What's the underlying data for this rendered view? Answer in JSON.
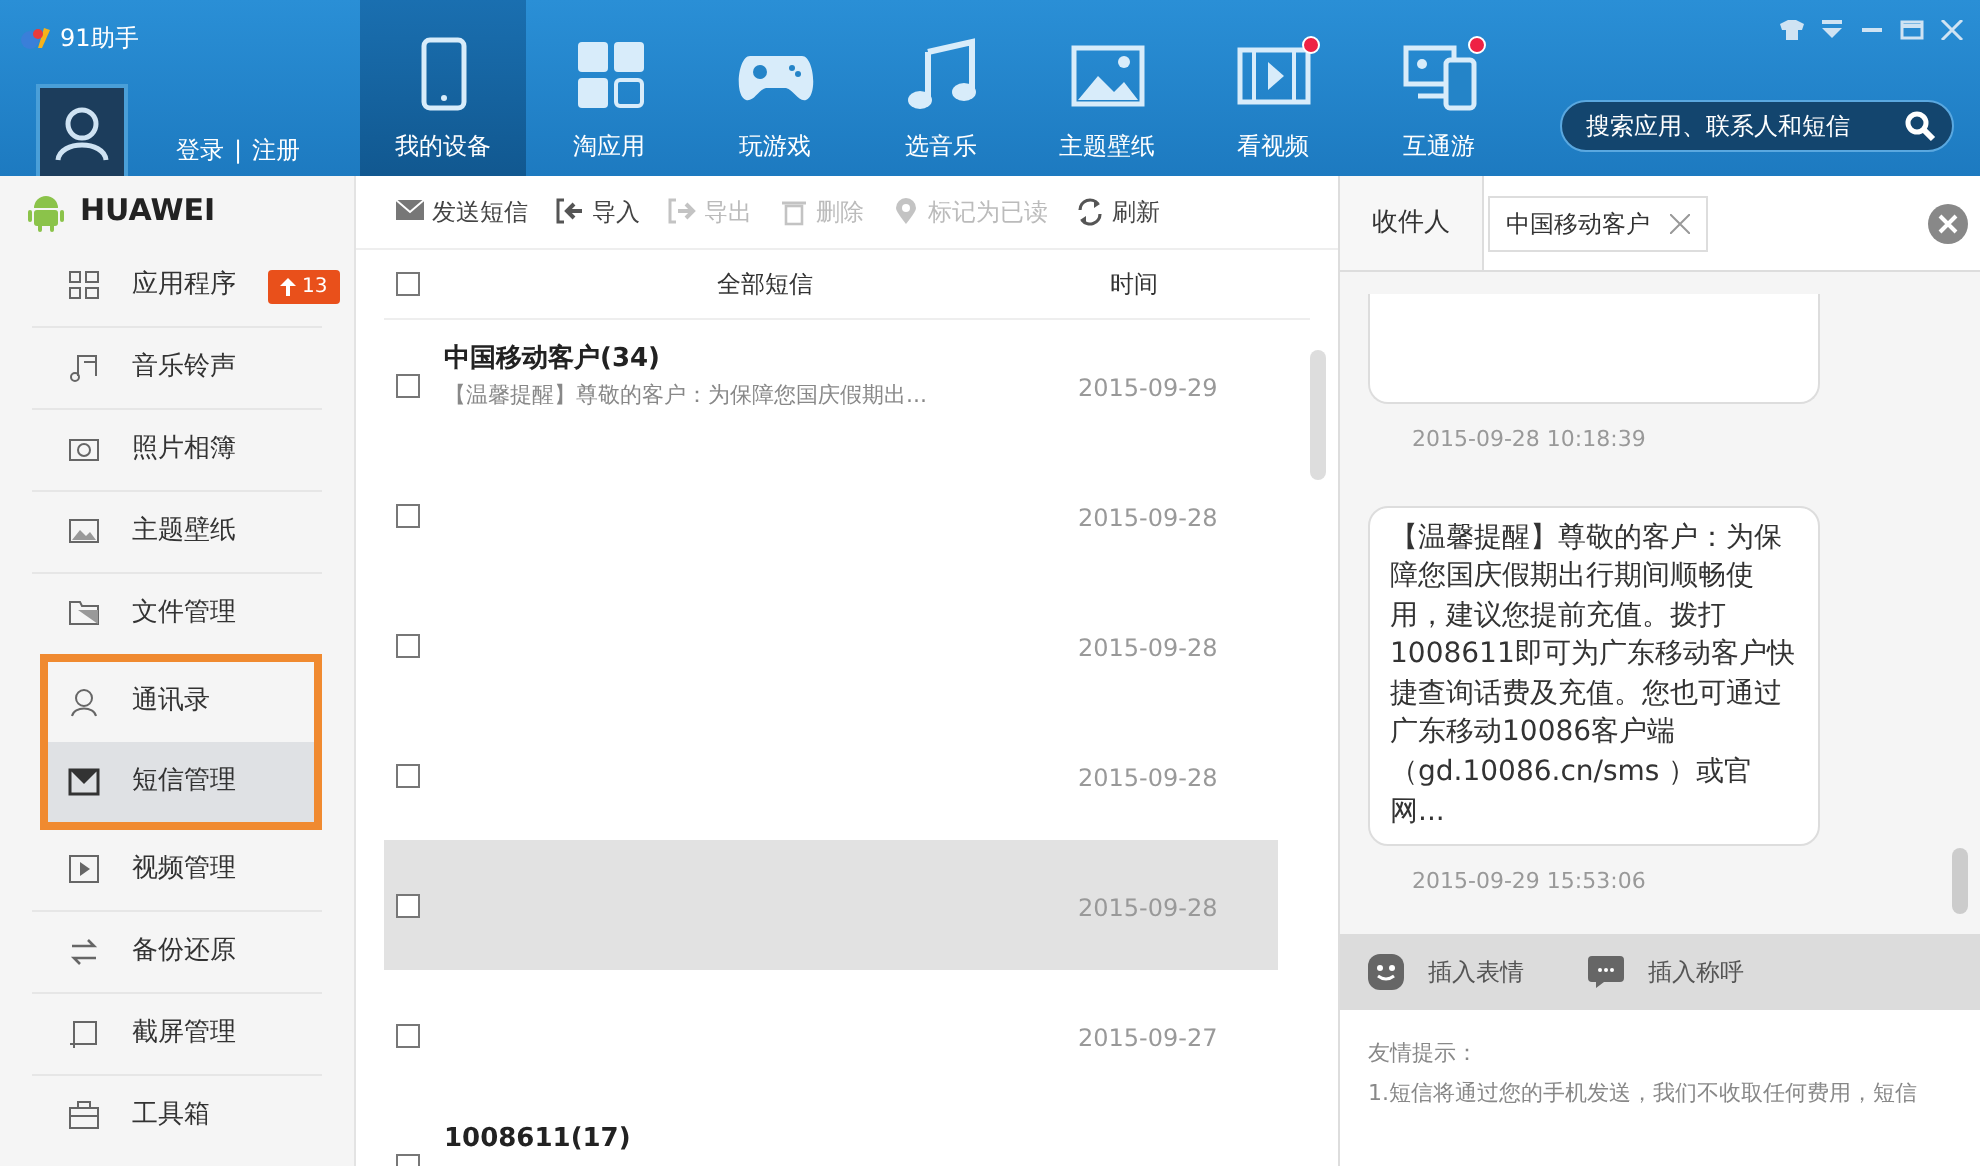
{
  "window": {
    "title": "91助手"
  },
  "account": {
    "login": "登录",
    "separator": "|",
    "register": "注册"
  },
  "nav_tabs": [
    {
      "label": "我的设备",
      "selected": true,
      "dot": false
    },
    {
      "label": "淘应用",
      "selected": false,
      "dot": false
    },
    {
      "label": "玩游戏",
      "selected": false,
      "dot": false
    },
    {
      "label": "选音乐",
      "selected": false,
      "dot": false
    },
    {
      "label": "主题壁纸",
      "selected": false,
      "dot": false
    },
    {
      "label": "看视频",
      "selected": false,
      "dot": true
    },
    {
      "label": "互通游",
      "selected": false,
      "dot": true
    }
  ],
  "search": {
    "placeholder": "搜索应用、联系人和短信"
  },
  "device": {
    "name": "HUAWEI"
  },
  "sidebar": {
    "items": [
      {
        "label": "应用程序",
        "selected": false,
        "outlined": false,
        "badge": "13"
      },
      {
        "label": "音乐铃声",
        "selected": false,
        "outlined": false
      },
      {
        "label": "照片相簿",
        "selected": false,
        "outlined": false
      },
      {
        "label": "主题壁纸",
        "selected": false,
        "outlined": false
      },
      {
        "label": "文件管理",
        "selected": false,
        "outlined": false
      },
      {
        "label": "通讯录",
        "selected": false,
        "outlined": true
      },
      {
        "label": "短信管理",
        "selected": true,
        "outlined": true
      },
      {
        "label": "视频管理",
        "selected": false,
        "outlined": false
      },
      {
        "label": "备份还原",
        "selected": false,
        "outlined": false
      },
      {
        "label": "截屏管理",
        "selected": false,
        "outlined": false
      },
      {
        "label": "工具箱",
        "selected": false,
        "outlined": false
      }
    ]
  },
  "toolbar": [
    {
      "label": "发送短信",
      "disabled": false
    },
    {
      "label": "导入",
      "disabled": false
    },
    {
      "label": "导出",
      "disabled": true
    },
    {
      "label": "删除",
      "disabled": true
    },
    {
      "label": "标记为已读",
      "disabled": true
    },
    {
      "label": "刷新",
      "disabled": false
    }
  ],
  "message_list": {
    "select_all_checked": false,
    "columns": [
      "全部短信",
      "时间"
    ],
    "rows": [
      {
        "sender": "中国移动客户(34)",
        "preview": "【温馨提醒】尊敬的客户：为保障您国庆假期出...",
        "date": "2015-09-29",
        "checked": false,
        "hovered": false
      },
      {
        "date": "2015-09-28",
        "checked": false,
        "hovered": false
      },
      {
        "date": "2015-09-28",
        "checked": false,
        "hovered": false
      },
      {
        "date": "2015-09-28",
        "checked": false,
        "hovered": false
      },
      {
        "date": "2015-09-28",
        "checked": false,
        "hovered": true
      },
      {
        "date": "2015-09-27",
        "checked": false,
        "hovered": false
      },
      {
        "sender": "1008611(17)",
        "checked": false,
        "hovered": false
      }
    ]
  },
  "conversation": {
    "recipient_label": "收件人",
    "recipient": "中国移动客户",
    "messages": [
      {
        "time": "2015-09-28 10:18:39"
      },
      {
        "text": "【温馨提醒】尊敬的客户：为保障您国庆假期出行期间顺畅使用，建议您提前充值。拨打1008611即可为广东移动客户快捷查询话费及充值。您也可通过广东移动10086客户端（gd.10086.cn/sms ）或官网...",
        "time": "2015-09-29 15:53:06"
      }
    ],
    "compose_tools": [
      "插入表情",
      "插入称呼"
    ],
    "tips_title": "友情提示：",
    "tips": [
      "1.短信将通过您的手机发送，我们不收取任何费用，短信"
    ]
  }
}
